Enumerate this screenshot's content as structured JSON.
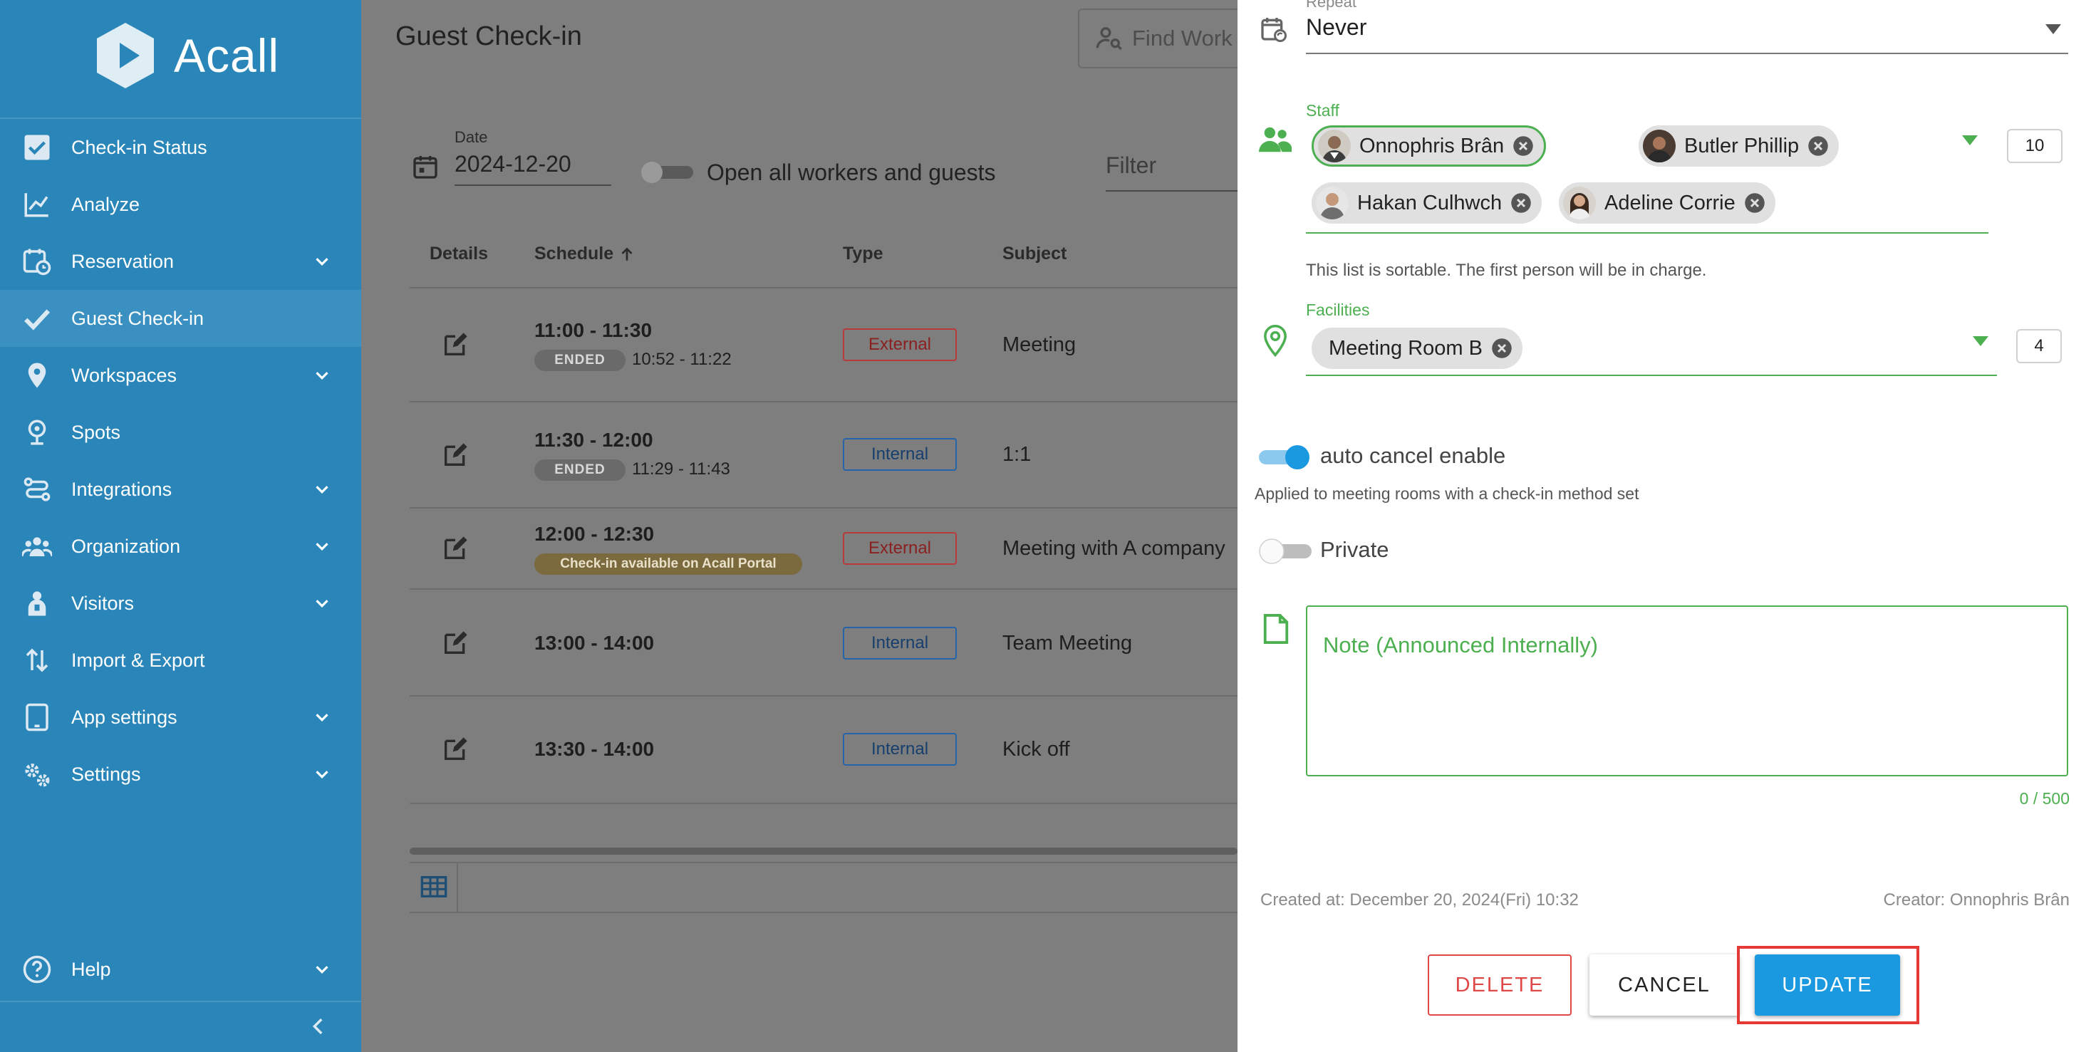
{
  "app": {
    "name": "Acall"
  },
  "sidebar": {
    "items": [
      {
        "label": "Check-in Status",
        "icon": "checkbox-icon",
        "expandable": false
      },
      {
        "label": "Analyze",
        "icon": "chart-line-icon",
        "expandable": false
      },
      {
        "label": "Reservation",
        "icon": "calendar-clock-icon",
        "expandable": true
      },
      {
        "label": "Guest Check-in",
        "icon": "check-icon",
        "expandable": false,
        "active": true
      },
      {
        "label": "Workspaces",
        "icon": "location-pin-icon",
        "expandable": true
      },
      {
        "label": "Spots",
        "icon": "map-marker-icon",
        "expandable": false
      },
      {
        "label": "Integrations",
        "icon": "integrations-icon",
        "expandable": true
      },
      {
        "label": "Organization",
        "icon": "people-icon",
        "expandable": true
      },
      {
        "label": "Visitors",
        "icon": "visitor-icon",
        "expandable": true
      },
      {
        "label": "Import & Export",
        "icon": "import-export-icon",
        "expandable": false
      },
      {
        "label": "App settings",
        "icon": "tablet-icon",
        "expandable": true
      },
      {
        "label": "Settings",
        "icon": "gears-icon",
        "expandable": true
      }
    ],
    "help": {
      "label": "Help",
      "icon": "help-icon"
    }
  },
  "main": {
    "title": "Guest Check-in",
    "find_placeholder": "Find Work",
    "date_label": "Date",
    "date_value": "2024-12-20",
    "open_all_label": "Open all workers and guests",
    "filter_placeholder": "Filter",
    "columns": {
      "details": "Details",
      "schedule": "Schedule",
      "type": "Type",
      "subject": "Subject"
    },
    "rows": [
      {
        "time": "11:00 - 11:30",
        "status": "ENDED",
        "actual": "10:52 - 11:22",
        "type": "External",
        "subject": "Meeting"
      },
      {
        "time": "11:30 - 12:00",
        "status": "ENDED",
        "actual": "11:29 - 11:43",
        "type": "Internal",
        "subject": "1:1"
      },
      {
        "time": "12:00 - 12:30",
        "status": "Check-in available on Acall Portal",
        "type": "External",
        "subject": "Meeting with A company"
      },
      {
        "time": "13:00 - 14:00",
        "type": "Internal",
        "subject": "Team Meeting"
      },
      {
        "time": "13:30 - 14:00",
        "type": "Internal",
        "subject": "Kick off"
      }
    ]
  },
  "panel": {
    "repeat": {
      "label": "Repeat",
      "value": "Never"
    },
    "staff": {
      "label": "Staff",
      "count": "10",
      "members": [
        "Onnophris Brân",
        "Butler Phillip",
        "Hakan Culhwch",
        "Adeline Corrie"
      ],
      "note": "This list is sortable. The first person will be in charge."
    },
    "facilities": {
      "label": "Facilities",
      "count": "4",
      "items": [
        "Meeting Room B"
      ]
    },
    "auto_cancel": {
      "label": "auto cancel enable",
      "help": "Applied to meeting rooms with a check-in method set",
      "enabled": true
    },
    "private": {
      "label": "Private",
      "enabled": false
    },
    "note": {
      "placeholder": "Note (Announced Internally)",
      "counter": "0 / 500"
    },
    "created_at": "Created at: December 20, 2024(Fri) 10:32",
    "creator": "Creator: Onnophris Brân",
    "buttons": {
      "delete": "DELETE",
      "cancel": "CANCEL",
      "update": "UPDATE"
    }
  },
  "colors": {
    "sidebar": "#2a86b8",
    "accent_green": "#4caf50",
    "primary_blue": "#1a98e0",
    "danger_red": "#e04848",
    "highlight": "#e53935"
  }
}
